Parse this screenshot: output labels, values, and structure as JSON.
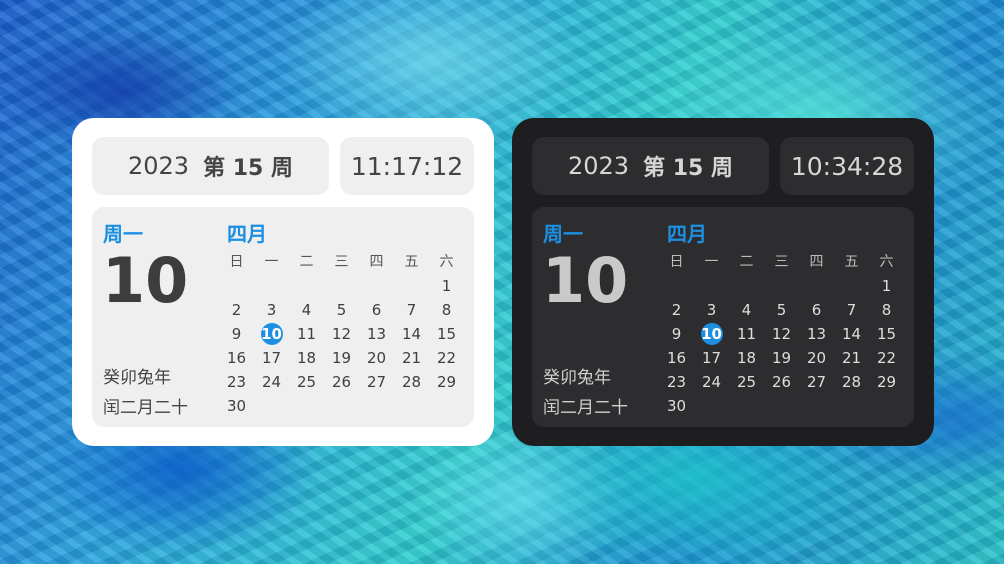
{
  "widgets": [
    {
      "theme": "light",
      "year": "2023",
      "week": "第 15 周",
      "time": "11:17:12",
      "weekday": "周一",
      "day": "10",
      "lunar_year": "癸卯兔年",
      "lunar_date": "闰二月二十",
      "month": "四月",
      "weekday_headers": [
        "日",
        "一",
        "二",
        "三",
        "四",
        "五",
        "六"
      ],
      "days": [
        "",
        "",
        "",
        "",
        "",
        "",
        "1",
        "2",
        "3",
        "4",
        "5",
        "6",
        "7",
        "8",
        "9",
        "10",
        "11",
        "12",
        "13",
        "14",
        "15",
        "16",
        "17",
        "18",
        "19",
        "20",
        "21",
        "22",
        "23",
        "24",
        "25",
        "26",
        "27",
        "28",
        "29",
        "30"
      ],
      "today": "10"
    },
    {
      "theme": "dark",
      "year": "2023",
      "week": "第 15 周",
      "time": "10:34:28",
      "weekday": "周一",
      "day": "10",
      "lunar_year": "癸卯兔年",
      "lunar_date": "闰二月二十",
      "month": "四月",
      "weekday_headers": [
        "日",
        "一",
        "二",
        "三",
        "四",
        "五",
        "六"
      ],
      "days": [
        "",
        "",
        "",
        "",
        "",
        "",
        "1",
        "2",
        "3",
        "4",
        "5",
        "6",
        "7",
        "8",
        "9",
        "10",
        "11",
        "12",
        "13",
        "14",
        "15",
        "16",
        "17",
        "18",
        "19",
        "20",
        "21",
        "22",
        "23",
        "24",
        "25",
        "26",
        "27",
        "28",
        "29",
        "30"
      ],
      "today": "10"
    }
  ],
  "colors": {
    "accent": "#1c8fe2",
    "light_bg": "#ffffff",
    "light_tile": "#efefef",
    "dark_bg": "#1e1e20",
    "dark_tile": "#2d2d30"
  }
}
